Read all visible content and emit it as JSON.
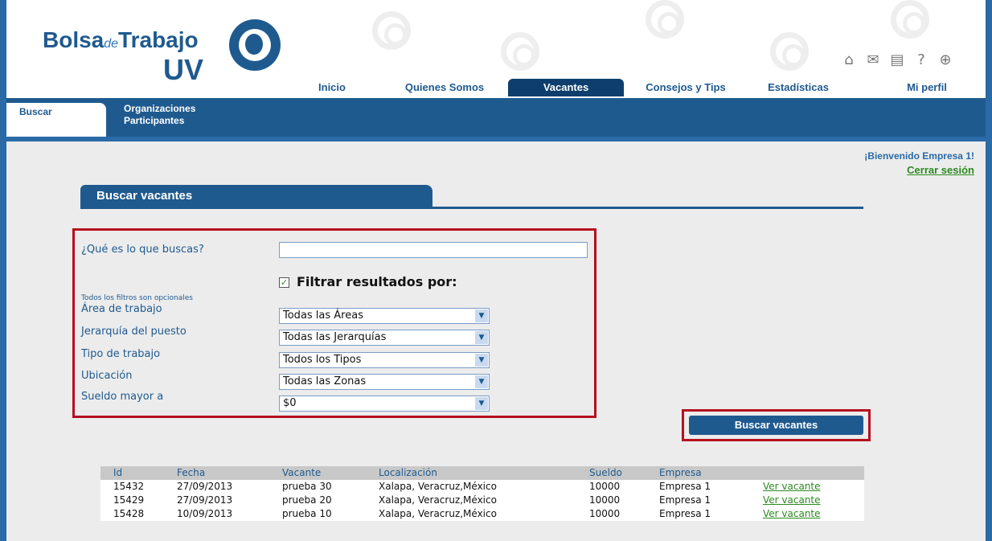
{
  "logo": {
    "part1": "Bolsa",
    "part2": "de",
    "part3": "Trabajo",
    "part4": "UV"
  },
  "top_icons": [
    {
      "name": "home-icon",
      "glyph": "⌂"
    },
    {
      "name": "mail-icon",
      "glyph": "✉"
    },
    {
      "name": "document-icon",
      "glyph": "▤"
    },
    {
      "name": "help-icon",
      "glyph": "?"
    },
    {
      "name": "globe-icon",
      "glyph": "⊕"
    }
  ],
  "top_nav": [
    "Inicio",
    "Quienes Somos",
    "Vacantes",
    "Consejos y Tips",
    "Estadísticas",
    "Mi perfil"
  ],
  "sub_nav": {
    "buscar": "Buscar",
    "organizaciones": "Organizaciones Participantes"
  },
  "welcome": {
    "greeting": "¡Bienvenido Empresa 1!",
    "logout": "Cerrar sesión"
  },
  "section_title": "Buscar vacantes",
  "form": {
    "question_label": "¿Qué es lo que buscas?",
    "query_value": "",
    "filter_checkbox_label": "Filtrar resultados por:",
    "filter_note": "Todos los filtros son opcionales",
    "area_label": "Área de trabajo",
    "area_value": "Todas las Áreas",
    "jerarquia_label": "Jerarquía del puesto",
    "jerarquia_value": "Todas las Jerarquías",
    "tipo_label": "Tipo de trabajo",
    "tipo_value": "Todos los Tipos",
    "ubicacion_label": "Ubicación",
    "ubicacion_value": "Todas las Zonas",
    "sueldo_label": "Sueldo mayor a",
    "sueldo_value": "$0",
    "submit_label": "Buscar vacantes"
  },
  "results": {
    "headers": [
      "Id",
      "Fecha",
      "Vacante",
      "Localización",
      "Sueldo",
      "Empresa"
    ],
    "rows": [
      {
        "id": "15432",
        "fecha": "27/09/2013",
        "vacante": "prueba 30",
        "loc": "Xalapa, Veracruz,México",
        "sueldo": "10000",
        "empresa": "Empresa 1",
        "link": "Ver vacante"
      },
      {
        "id": "15429",
        "fecha": "27/09/2013",
        "vacante": "prueba 20",
        "loc": "Xalapa, Veracruz,México",
        "sueldo": "10000",
        "empresa": "Empresa 1",
        "link": "Ver vacante"
      },
      {
        "id": "15428",
        "fecha": "10/09/2013",
        "vacante": "prueba 10",
        "loc": "Xalapa, Veracruz,México",
        "sueldo": "10000",
        "empresa": "Empresa 1",
        "link": "Ver vacante"
      }
    ]
  }
}
